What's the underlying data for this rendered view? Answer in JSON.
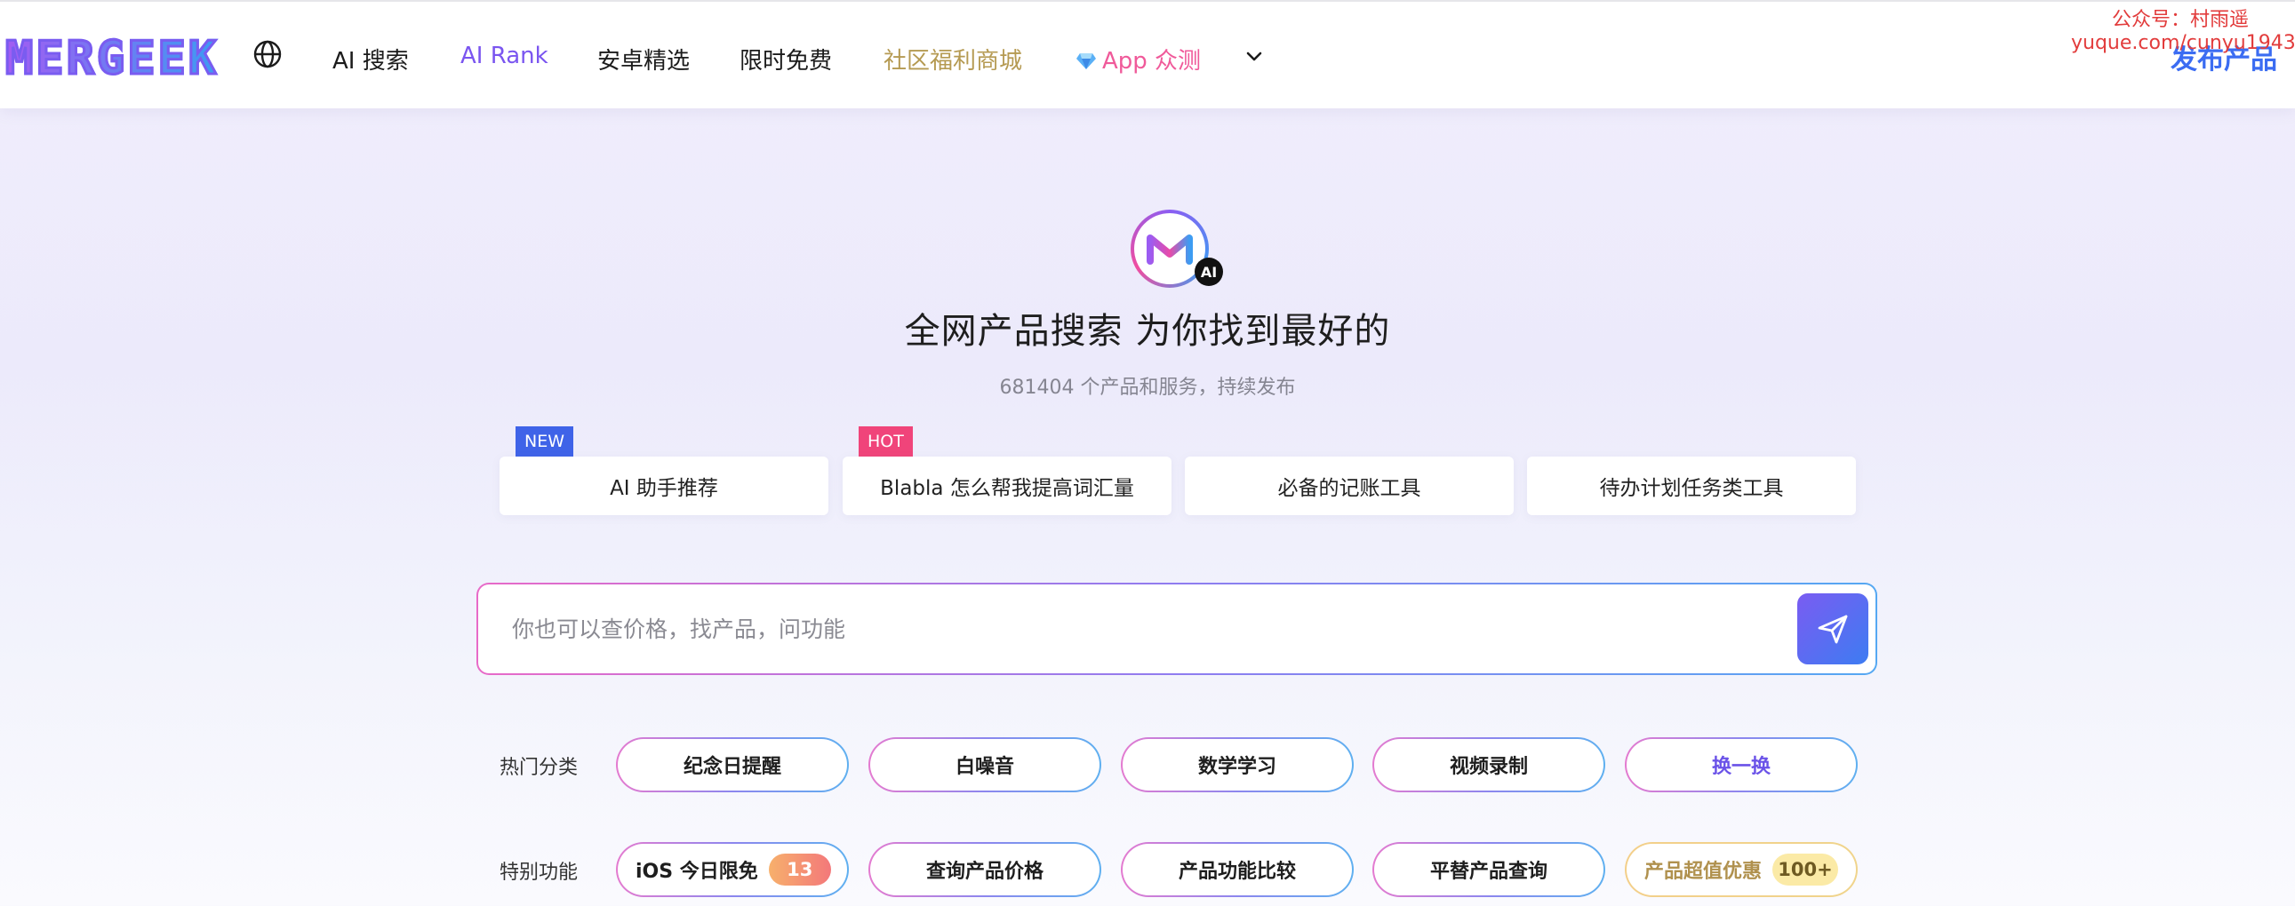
{
  "header": {
    "logo": "MERGEEK",
    "nav": [
      {
        "label": "AI 搜索"
      },
      {
        "label": "AI Rank"
      },
      {
        "label": "安卓精选"
      },
      {
        "label": "限时免费"
      },
      {
        "label": "社区福利商城"
      },
      {
        "label": "App 众测"
      }
    ],
    "publish_label": "发布产品",
    "watermark_line1": "公众号：村雨遥",
    "watermark_line2": "yuque.com/cunyu1943"
  },
  "hero": {
    "logo_letter": "M",
    "ai_badge": "AI",
    "title": "全网产品搜索 为你找到最好的",
    "subtitle": "681404 个产品和服务，持续发布"
  },
  "cards": [
    {
      "label": "AI 助手推荐",
      "tag": "NEW"
    },
    {
      "label": "Blabla 怎么帮我提高词汇量",
      "tag": "HOT"
    },
    {
      "label": "必备的记账工具"
    },
    {
      "label": "待办计划任务类工具"
    }
  ],
  "search": {
    "placeholder": "你也可以查价格，找产品，问功能",
    "value": ""
  },
  "hot_categories": {
    "label": "热门分类",
    "items": [
      "纪念日提醒",
      "白噪音",
      "数学学习",
      "视频录制"
    ],
    "swap_label": "换一换"
  },
  "special": {
    "label": "特别功能",
    "ios_label": "iOS 今日限免",
    "ios_count": "13",
    "items": [
      "查询产品价格",
      "产品功能比较",
      "平替产品查询"
    ],
    "deal_label": "产品超值优惠",
    "deal_count": "100+"
  },
  "colors": {
    "accent_purple": "#7a55f0",
    "accent_blue": "#3b6cf2",
    "gold": "#b59a52",
    "pink": "#f05a9a",
    "watermark_red": "#e23c3c"
  },
  "icons": [
    "globe-icon",
    "diamond-icon",
    "chevron-down-icon",
    "send-icon"
  ]
}
